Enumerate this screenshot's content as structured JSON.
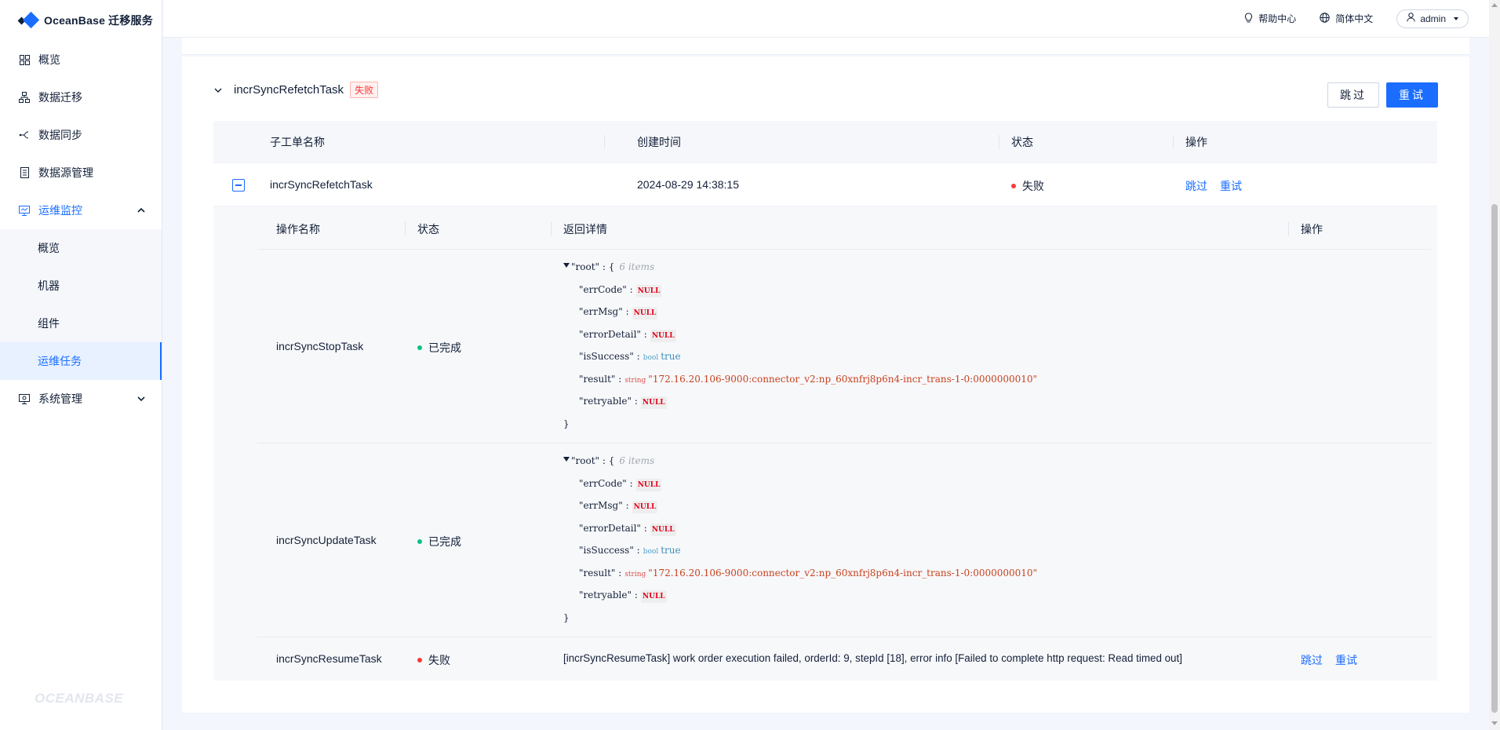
{
  "app": {
    "title": "OceanBase 迁移服务",
    "footer_brand": "OCEANBASE"
  },
  "header": {
    "help": "帮助中心",
    "language": "简体中文",
    "user": "admin"
  },
  "sidebar": {
    "items": [
      {
        "label": "概览",
        "icon": "grid-icon"
      },
      {
        "label": "数据迁移",
        "icon": "sitemap-icon"
      },
      {
        "label": "数据同步",
        "icon": "branch-icon"
      },
      {
        "label": "数据源管理",
        "icon": "database-doc-icon"
      },
      {
        "label": "运维监控",
        "icon": "monitor-icon"
      },
      {
        "label": "系统管理",
        "icon": "settings-monitor-icon"
      }
    ],
    "ops_sub": [
      {
        "label": "概览"
      },
      {
        "label": "机器"
      },
      {
        "label": "组件"
      },
      {
        "label": "运维任务"
      }
    ],
    "active": "运维任务"
  },
  "task": {
    "name": "incrSyncRefetchTask",
    "status_tag": "失败",
    "skip_label": "跳过",
    "retry_label": "重试"
  },
  "table": {
    "columns": [
      "子工单名称",
      "创建时间",
      "状态",
      "操作"
    ],
    "row": {
      "name": "incrSyncRefetchTask",
      "created": "2024-08-29 14:38:15",
      "status": "失败",
      "action_skip": "跳过",
      "action_retry": "重试"
    }
  },
  "sub_table": {
    "columns": [
      "操作名称",
      "状态",
      "返回详情",
      "操作"
    ],
    "rows": [
      {
        "name": "incrSyncStopTask",
        "status": "已完成",
        "json": {
          "root": "\"root\"",
          "colon": ":",
          "brace_open": "{",
          "meta": "6 items",
          "brace_close": "}",
          "errCode": "\"errCode\"",
          "errMsg": "\"errMsg\"",
          "errorDetail": "\"errorDetail\"",
          "isSuccess": "\"isSuccess\"",
          "result": "\"result\"",
          "retryable": "\"retryable\"",
          "null": "NULL",
          "bool_type": "bool",
          "bool_val": "true",
          "str_type": "string",
          "result_val": "\"172.16.20.106-9000:connector_v2:np_60xnfrj8p6n4-incr_trans-1-0:0000000010\""
        }
      },
      {
        "name": "incrSyncUpdateTask",
        "status": "已完成",
        "json": {
          "root": "\"root\"",
          "colon": ":",
          "brace_open": "{",
          "meta": "6 items",
          "brace_close": "}",
          "errCode": "\"errCode\"",
          "errMsg": "\"errMsg\"",
          "errorDetail": "\"errorDetail\"",
          "isSuccess": "\"isSuccess\"",
          "result": "\"result\"",
          "retryable": "\"retryable\"",
          "null": "NULL",
          "bool_type": "bool",
          "bool_val": "true",
          "str_type": "string",
          "result_val": "\"172.16.20.106-9000:connector_v2:np_60xnfrj8p6n4-incr_trans-1-0:0000000010\""
        }
      },
      {
        "name": "incrSyncResumeTask",
        "status": "失败",
        "detail": "[incrSyncResumeTask] work order execution failed, orderId: 9, stepId [18], error info [Failed to complete http request: Read timed out]",
        "action_skip": "跳过",
        "action_retry": "重试"
      }
    ]
  },
  "colors": {
    "accent": "#1a6dff",
    "danger": "#f93939",
    "success": "#0ac185"
  }
}
